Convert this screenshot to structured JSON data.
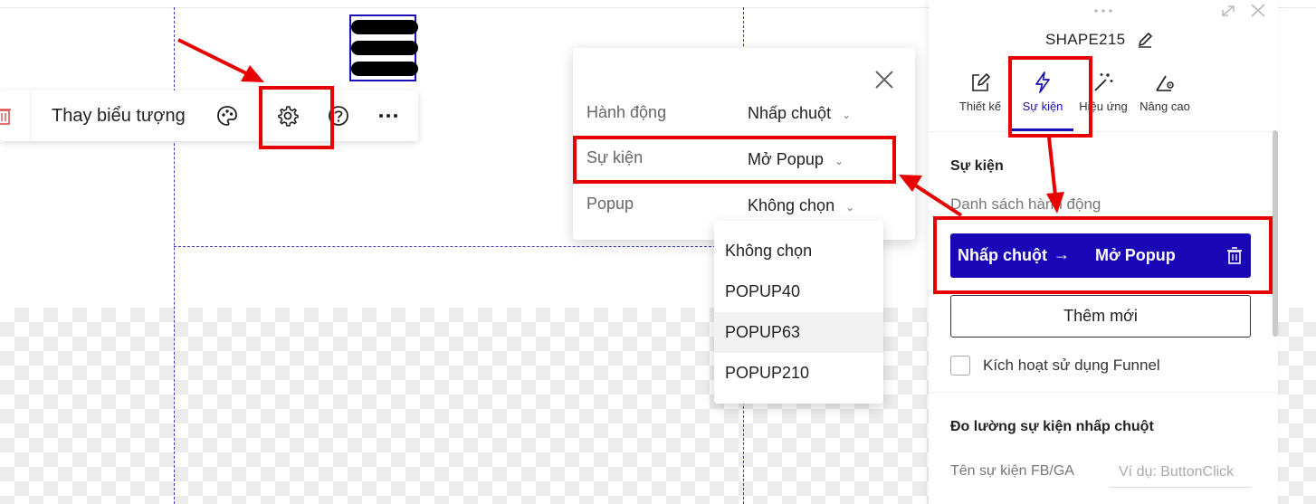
{
  "toolbar": {
    "replace_icon_label": "Thay biểu tượng"
  },
  "event_popup": {
    "rows": [
      {
        "label": "Hành động",
        "value": "Nhấp chuột"
      },
      {
        "label": "Sự kiện",
        "value": "Mở Popup"
      },
      {
        "label": "Popup",
        "value": "Không chọn"
      }
    ],
    "dropdown_options": [
      "Không chọn",
      "POPUP40",
      "POPUP63",
      "POPUP210"
    ],
    "highlighted_option": "POPUP63"
  },
  "panel": {
    "title": "SHAPE215",
    "tabs": [
      {
        "label": "Thiết kế",
        "icon": "edit-square-icon"
      },
      {
        "label": "Sự kiện",
        "icon": "lightning-icon"
      },
      {
        "label": "Hiệu ứng",
        "icon": "magic-wand-icon"
      },
      {
        "label": "Nâng cao",
        "icon": "wand-gear-icon"
      }
    ],
    "active_tab": "Sự kiện",
    "section_heading": "Sự kiện",
    "action_list_label": "Danh sách hành động",
    "action_item": {
      "trigger": "Nhấp chuột",
      "arrow": "→",
      "action": "Mở Popup"
    },
    "add_new_label": "Thêm mới",
    "funnel_label": "Kích hoạt sử dụng Funnel",
    "tracking_heading": "Đo lường sự kiện nhấp chuột",
    "fb_ga_label": "Tên sự kiện FB/GA",
    "fb_ga_placeholder": "Ví dụ: ButtonClick"
  },
  "colors": {
    "accent": "#1a06b7",
    "annotation_red": "#e60000",
    "guide_blue": "#3b3bb5"
  }
}
